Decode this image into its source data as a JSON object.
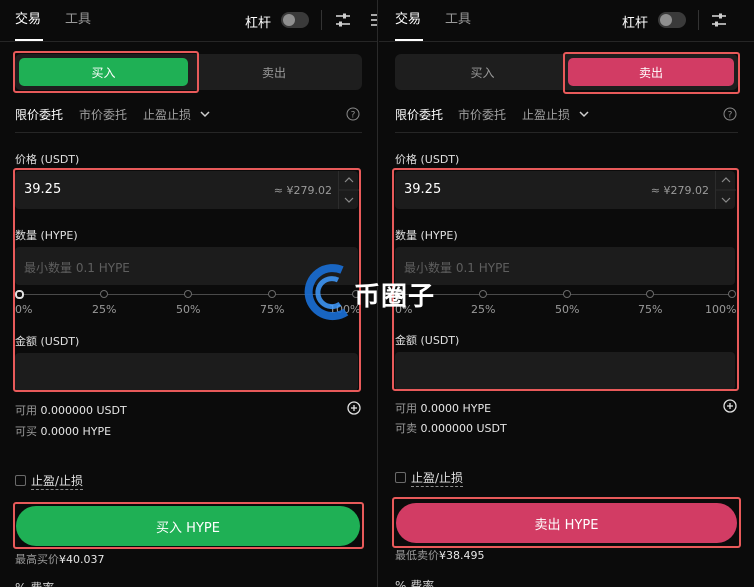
{
  "left": {
    "tabs": [
      "交易",
      "工具"
    ],
    "leverage_label": "杠杆",
    "side_buy": "买入",
    "side_sell": "卖出",
    "order_types": [
      "限价委托",
      "市价委托",
      "止盈止损"
    ],
    "price_label": "价格 (USDT)",
    "price_value": "39.25",
    "price_approx": "≈ ¥279.02",
    "qty_label": "数量 (HYPE)",
    "qty_placeholder": "最小数量 0.1 HYPE",
    "percents": [
      "0%",
      "25%",
      "50%",
      "75%",
      "100%"
    ],
    "amount_label": "金额 (USDT)",
    "avail_label": "可用",
    "avail_value": "0.000000 USDT",
    "can_label": "可买",
    "can_value": "0.0000 HYPE",
    "tpsl_label": "止盈/止损",
    "submit": "买入 HYPE",
    "bottom_label": "最高买价",
    "bottom_value": "¥40.037",
    "cut_text": "% 费率"
  },
  "right": {
    "tabs": [
      "交易",
      "工具"
    ],
    "leverage_label": "杠杆",
    "side_buy": "买入",
    "side_sell": "卖出",
    "order_types": [
      "限价委托",
      "市价委托",
      "止盈止损"
    ],
    "price_label": "价格 (USDT)",
    "price_value": "39.25",
    "price_approx": "≈ ¥279.02",
    "qty_label": "数量 (HYPE)",
    "qty_placeholder": "最小数量 0.1 HYPE",
    "percents": [
      "0%",
      "25%",
      "50%",
      "75%",
      "100%"
    ],
    "amount_label": "金额 (USDT)",
    "avail_label": "可用",
    "avail_value": "0.0000 HYPE",
    "can_label": "可卖",
    "can_value": "0.000000 USDT",
    "tpsl_label": "止盈/止损",
    "submit": "卖出 HYPE",
    "bottom_label": "最低卖价",
    "bottom_value": "¥38.495",
    "cut_text": "% 费率"
  },
  "watermark": "币圈子",
  "colors": {
    "buy": "#1fb055",
    "sell": "#d23c64",
    "highlight": "#e85a5a",
    "background": "#0b0b0b",
    "field": "#1c1c1c"
  },
  "icons": [
    "sliders-icon",
    "menu-icon",
    "chevron-down-icon",
    "help-icon",
    "plus-circle-icon",
    "chevron-up-icon"
  ]
}
